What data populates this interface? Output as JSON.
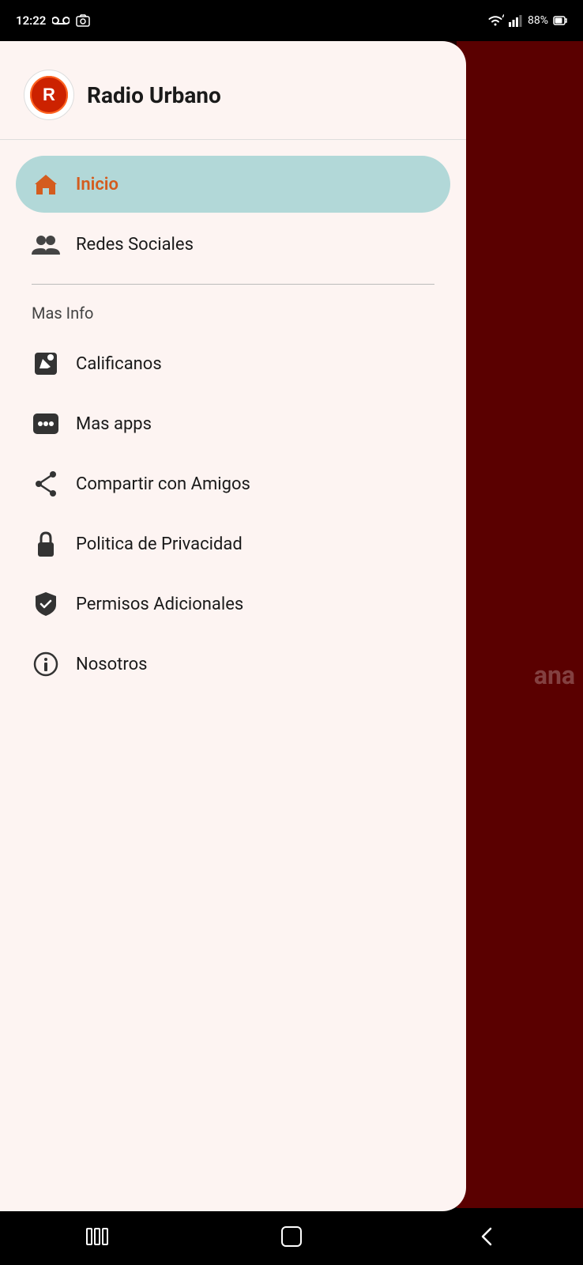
{
  "status_bar": {
    "time": "12:22",
    "battery": "88%",
    "wifi": true,
    "signal": true
  },
  "header": {
    "app_name": "Radio Urbano",
    "logo_alt": "Radio Urbano Logo"
  },
  "nav": {
    "items": [
      {
        "id": "inicio",
        "label": "Inicio",
        "active": true
      },
      {
        "id": "redes-sociales",
        "label": "Redes Sociales",
        "active": false
      }
    ]
  },
  "mas_info_section": {
    "label": "Mas Info",
    "items": [
      {
        "id": "calificanos",
        "label": "Calificanos"
      },
      {
        "id": "mas-apps",
        "label": "Mas apps"
      },
      {
        "id": "compartir",
        "label": "Compartir con Amigos"
      },
      {
        "id": "privacidad",
        "label": "Politica de Privacidad"
      },
      {
        "id": "permisos",
        "label": "Permisos Adicionales"
      },
      {
        "id": "nosotros",
        "label": "Nosotros"
      }
    ]
  },
  "bg_text": "ana",
  "bottom_nav": {
    "buttons": [
      "recent",
      "home",
      "back"
    ]
  }
}
